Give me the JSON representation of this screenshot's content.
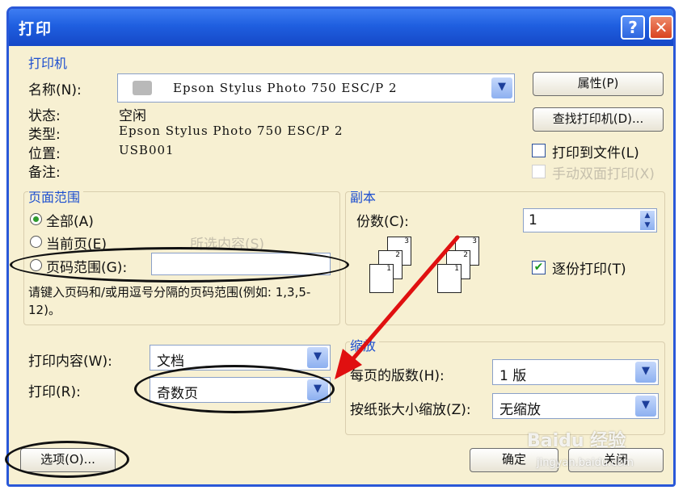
{
  "window": {
    "title": "打印",
    "help_btn": "?",
    "close_btn": "✕"
  },
  "printer": {
    "group_label": "打印机",
    "name_label": "名称(N):",
    "name_value": "Epson Stylus Photo 750 ESC/P 2",
    "status_label": "状态:",
    "status_value": "空闲",
    "type_label": "类型:",
    "type_value": "Epson Stylus Photo 750 ESC/P 2",
    "location_label": "位置:",
    "location_value": "USB001",
    "comment_label": "备注:",
    "properties_btn": "属性(P)",
    "find_btn": "查找打印机(D)...",
    "print_to_file": "打印到文件(L)",
    "manual_duplex": "手动双面打印(X)"
  },
  "page_range": {
    "group_label": "页面范围",
    "all": "全部(A)",
    "current": "当前页(E)",
    "selection": "所选内容(S)",
    "pages": "页码范围(G):",
    "pages_value": "",
    "hint": "请键入页码和/或用逗号分隔的页码范围(例如: 1,3,5-12)。"
  },
  "copies": {
    "group_label": "副本",
    "count_label": "份数(C):",
    "count_value": "1",
    "collate": "逐份打印(T)"
  },
  "content": {
    "print_what_label": "打印内容(W):",
    "print_what_value": "文档",
    "print_label": "打印(R):",
    "print_value": "奇数页"
  },
  "zoom": {
    "group_label": "缩放",
    "pages_per_sheet_label": "每页的版数(H):",
    "pages_per_sheet_value": "1 版",
    "scale_label": "按纸张大小缩放(Z):",
    "scale_value": "无缩放"
  },
  "buttons": {
    "options": "选项(O)...",
    "ok": "确定",
    "cancel": "关闭"
  },
  "watermark": {
    "logo": "Baidu 经验",
    "url": "jingyan.baidu.com"
  },
  "colors": {
    "title_bar": "#1f5fe0",
    "dialog_bg": "#f7f0d2",
    "annotation_arrow": "#e01010",
    "annotation_ellipse": "#111111"
  }
}
